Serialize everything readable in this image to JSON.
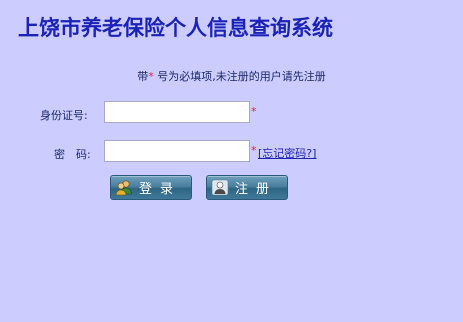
{
  "title": "上饶市养老保险个人信息查询系统",
  "notice": {
    "prefix": "带",
    "star": "*",
    "suffix": " 号为必填项,未注册的用户请先注册"
  },
  "form": {
    "id_label": "身份证号:",
    "id_value": "",
    "password_label": "密　码:",
    "password_value": "",
    "required_mark": "*",
    "forgot_link": "[忘记密码?]"
  },
  "buttons": {
    "login_label": "登录",
    "login_icon": "users-icon",
    "register_label": "注册",
    "register_icon": "user-icon"
  },
  "colors": {
    "background": "#ccccff",
    "title": "#1a22b8",
    "required": "#e0203a",
    "button": "#3f7898"
  }
}
